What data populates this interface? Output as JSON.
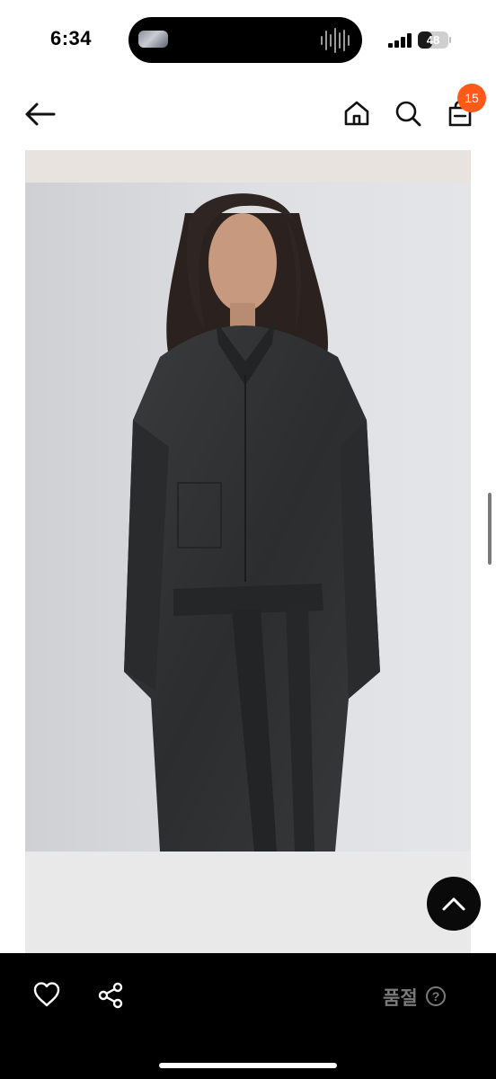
{
  "status_bar": {
    "time": "6:34",
    "battery_level": "48",
    "battery_fraction": 0.48
  },
  "nav": {
    "back_icon": "arrow-left-icon",
    "home_icon": "home-icon",
    "search_icon": "search-icon",
    "cart_icon": "shopping-bag-icon",
    "cart_count": "15",
    "badge_color": "#ff5a1a"
  },
  "product": {
    "image_description_icon": "product-photo"
  },
  "scroll_top": {
    "icon": "chevron-up-icon"
  },
  "bottom_bar": {
    "like_icon": "heart-icon",
    "share_icon": "share-icon",
    "status_label": "품절",
    "help_icon": "question-circle-icon",
    "help_symbol": "?",
    "background": "#000000"
  }
}
